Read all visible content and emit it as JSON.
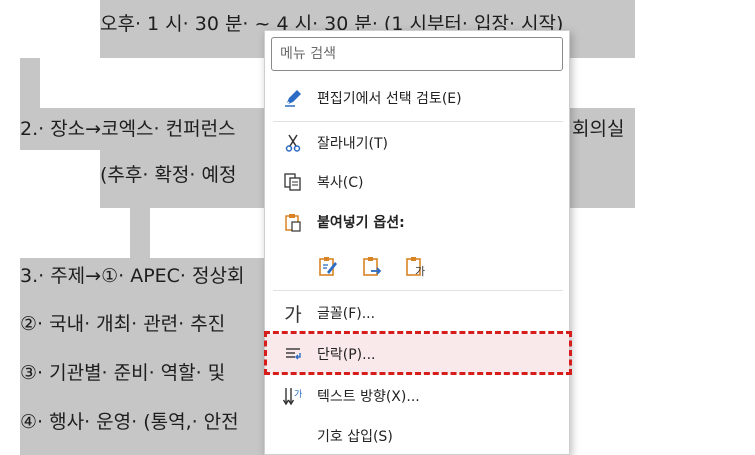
{
  "document": {
    "line1": "오후· 1 시· 30 분· ~ 4 시· 30 분· (1 시부터· 입장· 시작)",
    "line2_left": "2.· 장소→코엑스· 컨퍼런스",
    "line2_right": "회의실",
    "line3": "(추후· 확정· 예정",
    "line4": "3.· 주제→①· APEC· 정상회",
    "line5": "②· 국내· 개최· 관련· 추진",
    "line6": "③· 기관별· 준비· 역할· 및",
    "line7": "④· 행사· 운영· (통역,· 안전"
  },
  "menu": {
    "search_placeholder": "메뉴 검색",
    "items": [
      {
        "label": "편집기에서 선택 검토(E)",
        "icon": "pen-review-icon"
      },
      {
        "label": "잘라내기(T)",
        "icon": "scissors-icon"
      },
      {
        "label": "복사(C)",
        "icon": "copy-icon"
      },
      {
        "label": "붙여넣기 옵션:",
        "icon": "clipboard-icon"
      },
      {
        "label": "글꼴(F)...",
        "icon": "font-icon",
        "icon_text": "가"
      },
      {
        "label": "단락(P)...",
        "icon": "paragraph-icon"
      },
      {
        "label": "텍스트 방향(X)...",
        "icon": "text-direction-icon"
      },
      {
        "label": "기호 삽입(S)",
        "icon": ""
      }
    ],
    "paste_options": [
      {
        "icon": "paste-keep-formatting-icon"
      },
      {
        "icon": "paste-merge-formatting-icon"
      },
      {
        "icon": "paste-text-only-icon",
        "icon_text": "가"
      }
    ]
  },
  "colors": {
    "selection": "#c6c6c6",
    "highlight_fill": "#f9e9ea",
    "highlight_border": "#d71c1c",
    "icon_blue": "#2b6cc4",
    "icon_orange": "#d98324"
  }
}
